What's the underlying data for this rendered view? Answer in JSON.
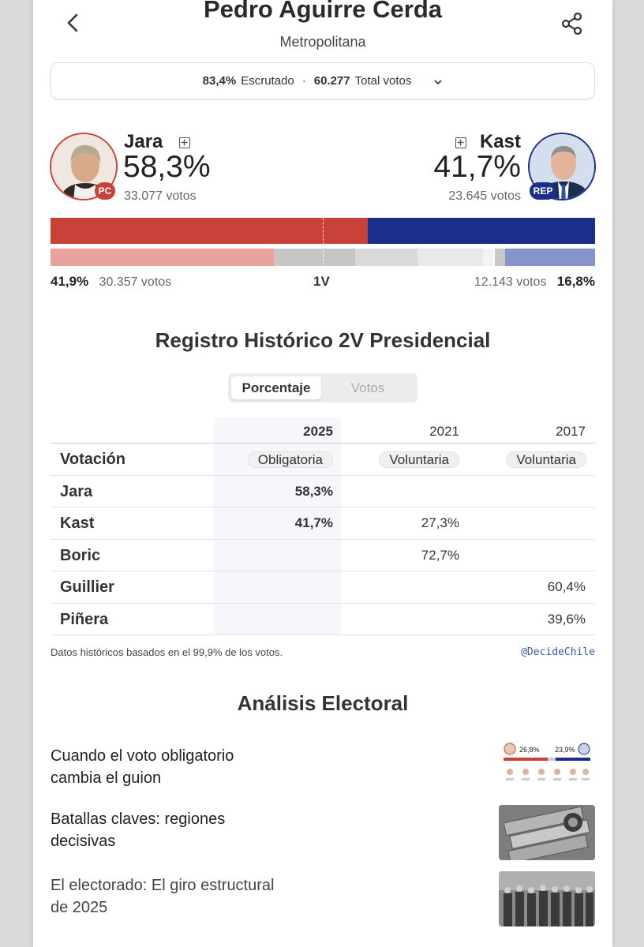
{
  "header": {
    "title": "Pedro Aguirre Cerda",
    "subtitle": "Metropolitana"
  },
  "summary": {
    "scrutinized_pct": "83,4%",
    "scrutinized_label": "Escrutado",
    "separator": "·",
    "total_votes": "60.277",
    "total_votes_label": "Total votos"
  },
  "candidates": {
    "left": {
      "name": "Jara",
      "pct": "58,3%",
      "votes": "33.077 votos",
      "party": "PC",
      "color": "#c9423a"
    },
    "right": {
      "name": "Kast",
      "pct": "41,7%",
      "votes": "23.645 votos",
      "party": "REP",
      "color": "#1b2f8a"
    }
  },
  "bars": {
    "second_round": {
      "left_fraction": 0.583,
      "right_fraction": 0.417
    },
    "first_round": [
      {
        "fraction": 0.419,
        "color": "#e8a39d"
      },
      {
        "fraction": 0.152,
        "color": "#c6c6c6"
      },
      {
        "fraction": 0.117,
        "color": "#d9d9d9"
      },
      {
        "fraction": 0.122,
        "color": "#e9e9e9"
      },
      {
        "fraction": 0.02,
        "color": "#f3f3f3"
      },
      {
        "fraction": 0.002,
        "color": "#ffffff"
      },
      {
        "fraction": 0.02,
        "color": "#c8c8c8"
      },
      {
        "fraction": 0.168,
        "color": "#8793cc"
      }
    ]
  },
  "first_round": {
    "left_pct": "41,9%",
    "left_votes": "30.357 votos",
    "label": "1V",
    "right_votes": "12.143 votos",
    "right_pct": "16,8%"
  },
  "history": {
    "title": "Registro Histórico 2V Presidencial",
    "toggle": {
      "active": "Porcentaje",
      "inactive": "Votos"
    },
    "years": [
      "2025",
      "2021",
      "2017"
    ],
    "votacion": {
      "label": "Votación",
      "values": [
        "Obligatoria",
        "Voluntaria",
        "Voluntaria"
      ]
    },
    "rows": [
      {
        "label": "Jara",
        "values": [
          "58,3%",
          "",
          ""
        ]
      },
      {
        "label": "Kast",
        "values": [
          "41,7%",
          "27,3%",
          ""
        ]
      },
      {
        "label": "Boric",
        "values": [
          "",
          "72,7%",
          ""
        ]
      },
      {
        "label": "Guillier",
        "values": [
          "",
          "",
          "60,4%"
        ]
      },
      {
        "label": "Piñera",
        "values": [
          "",
          "",
          "39,6%"
        ]
      }
    ],
    "footnote": "Datos históricos basados en el 99,9% de los votos.",
    "credit": "@DecideChile"
  },
  "analysis": {
    "title": "Análisis Electoral",
    "articles": [
      {
        "title": "Cuando el voto obligatorio cambia el guion",
        "thumb": "results-chart-thumbnail",
        "thumb_left_pct": "26,8%",
        "thumb_right_pct": "23,9%"
      },
      {
        "title": "Batallas claves: regiones decisivas",
        "thumb": "banknotes-thumbnail"
      },
      {
        "title": "El electorado: El giro estructural de 2025",
        "thumb": "candidates-group-thumbnail"
      }
    ]
  }
}
